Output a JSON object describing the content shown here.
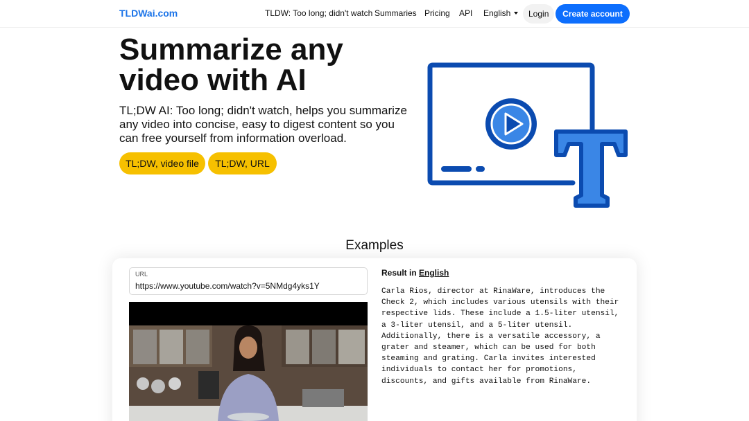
{
  "nav": {
    "brand": "TLDWai.com",
    "links": [
      "TLDW: Too long; didn't watch",
      "Summaries",
      "Pricing",
      "API"
    ],
    "language": "English",
    "login": "Login",
    "create_account": "Create account"
  },
  "hero": {
    "title": "Summarize any video with AI",
    "subtitle": "TL;DW AI: Too long; didn't watch, helps you summarize any video into concise, easy to digest content so you can free yourself from information overload.",
    "buttons": [
      "TL;DW, video file",
      "TL;DW, URL"
    ],
    "illustration_icon": "video-to-text-icon"
  },
  "examples": {
    "title": "Examples",
    "url_label": "URL",
    "url_value": "https://www.youtube.com/watch?v=5NMdg4yks1Y",
    "result_label": "Result in",
    "result_language": "English",
    "result_text": "Carla Rios, director at RinaWare, introduces the Check 2, which includes various utensils with their respective lids. These include a 1.5-liter utensil, a 3-liter utensil, and a 5-liter utensil. Additionally, there is a versatile accessory, a grater and steamer, which can be used for both steaming and grating. Carla invites interested individuals to contact her for promotions, discounts, and gifts available from RinaWare."
  },
  "colors": {
    "brand": "#1a73e8",
    "primary_button": "#0d6efd",
    "pill": "#f6c000",
    "illustration_dark": "#0b4bb0",
    "illustration_light": "#3a86e6"
  }
}
